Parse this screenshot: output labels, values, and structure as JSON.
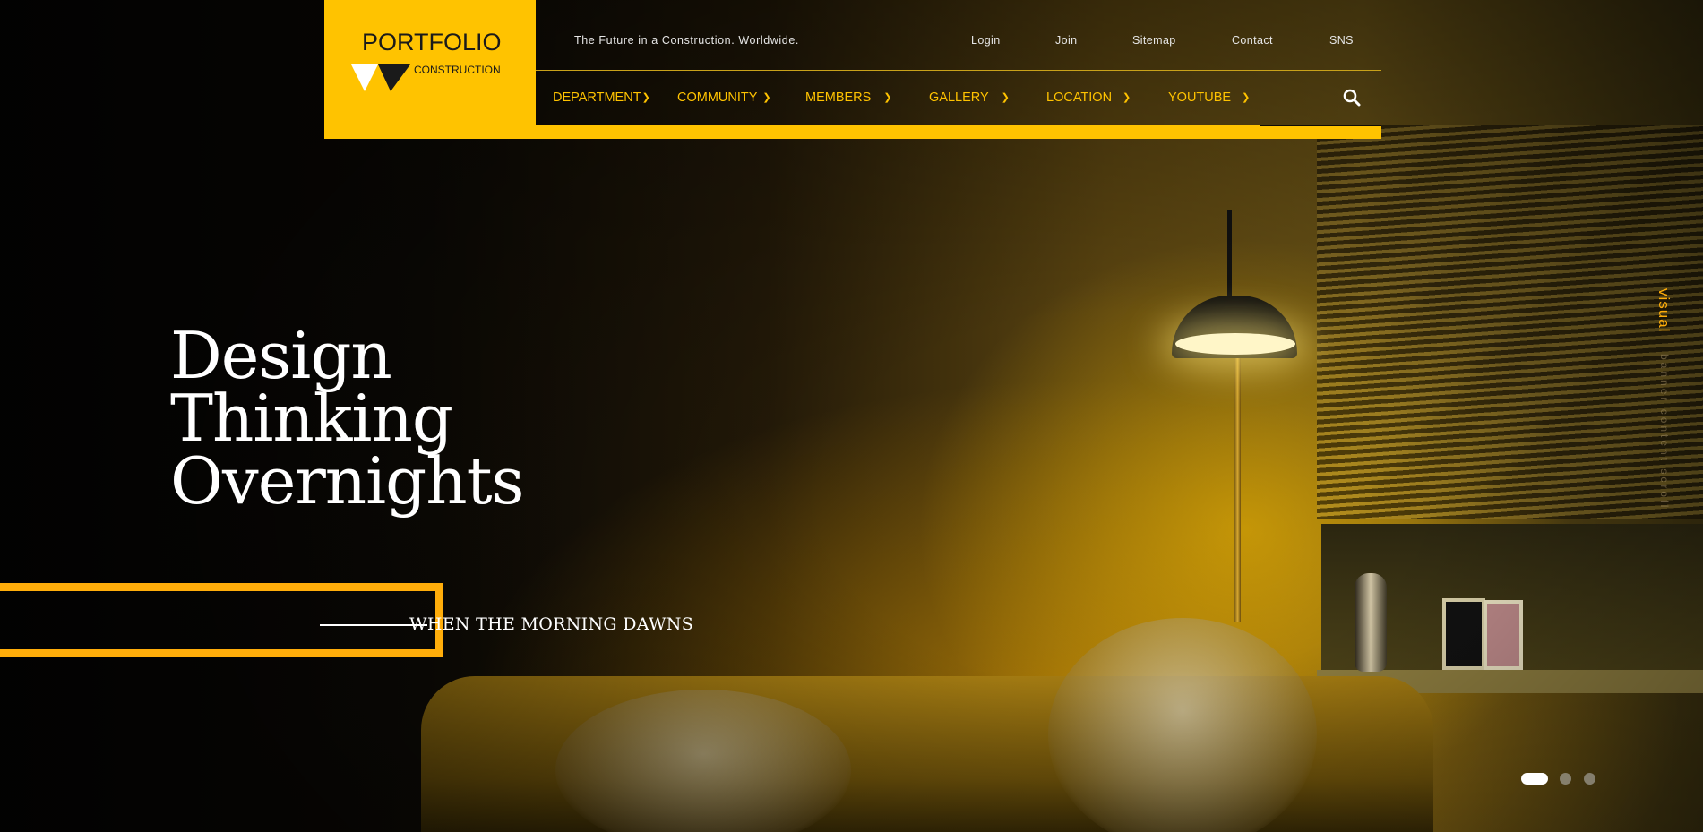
{
  "brand": {
    "title": "PORTFOLIO",
    "subtitle": "CONSTRUCTION",
    "color": "#ffc300"
  },
  "header": {
    "tagline": "The Future in a Construction. Worldwide.",
    "utility_links": [
      "Login",
      "Join",
      "Sitemap",
      "Contact",
      "SNS"
    ],
    "nav": [
      "DEPARTMENT",
      "COMMUNITY",
      "MEMBERS",
      "GALLERY",
      "LOCATION",
      "YOUTUBE"
    ],
    "search_icon": "search-icon"
  },
  "hero": {
    "title_lines": [
      "Design",
      "Thinking",
      "Overnights"
    ],
    "subtitle": "WHEN THE MORNING DAWNS",
    "accent_color": "#ffad0a"
  },
  "side_labels": {
    "active": "visual",
    "rest": "banner content scroll"
  },
  "pagination": {
    "total": 3,
    "active_index": 1
  }
}
